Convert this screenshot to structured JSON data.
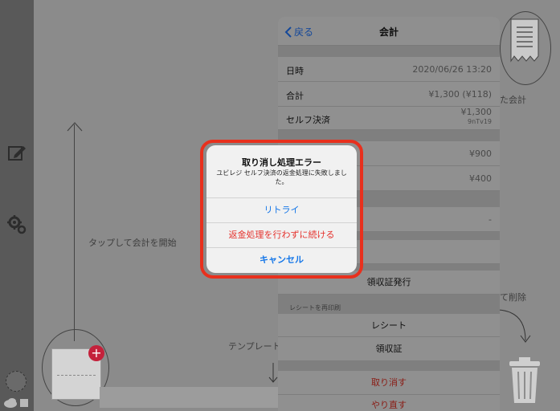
{
  "background": {
    "tap_hint": "タップして会計を開始",
    "template_text": "テンプレート",
    "accounted_text": "た会計",
    "delete_text": "て削除"
  },
  "panel": {
    "back_label": "戻る",
    "title": "会計",
    "rows": [
      {
        "label": "日時",
        "value": "2020/06/26 13:20"
      },
      {
        "label": "合計",
        "value": "¥1,300 (¥118)"
      },
      {
        "label": "セルフ決済",
        "value": "¥1,300",
        "sub": "9nTv19"
      }
    ],
    "amount_row1": "¥900",
    "amount_row2": "¥400",
    "dash_value": "-",
    "receipt_issue": "領収証発行",
    "reprint_section": "レシートを再印刷",
    "reprint_receipt": "レシート",
    "reprint_invoice": "領収証",
    "cancel_action": "取り消す",
    "redo_action": "やり直す"
  },
  "alert": {
    "title": "取り消し処理エラー",
    "message": "ユビレジ セルフ決済の返金処理に失敗しました。",
    "retry_label": "リトライ",
    "continue_label": "返金処理を行わずに続ける",
    "cancel_label": "キャンセル"
  },
  "colors": {
    "accent_blue": "#1476e8",
    "destructive_red": "#e5322d",
    "highlight_ring": "#e8301d",
    "badge_red": "#c4213b"
  },
  "icons": [
    "pencil-edit-icon",
    "gear-icon",
    "plus-icon",
    "cloud-icon",
    "receipt-icon",
    "trash-icon",
    "chevron-left-icon"
  ]
}
